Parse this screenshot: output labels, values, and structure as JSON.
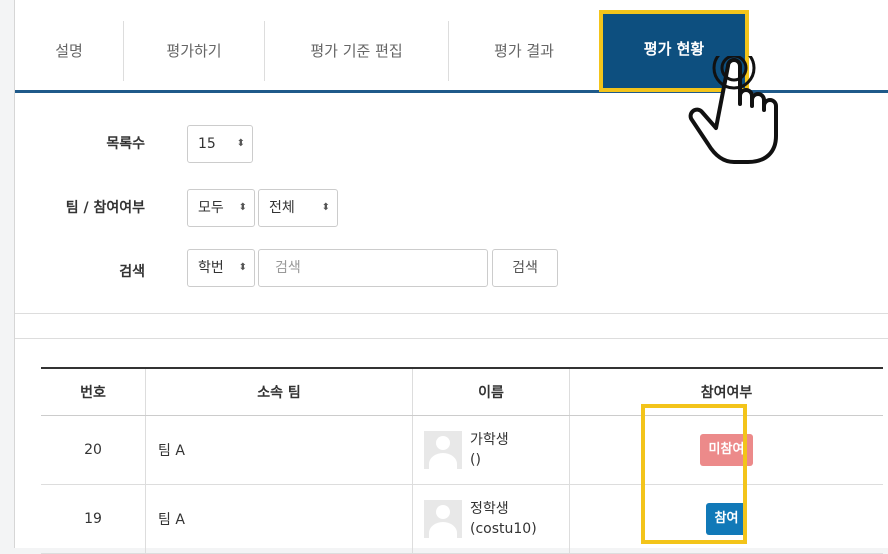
{
  "tabs": [
    {
      "label": "설명",
      "active": false
    },
    {
      "label": "평가하기",
      "active": false
    },
    {
      "label": "평가 기준 편집",
      "active": false
    },
    {
      "label": "평가 결과",
      "active": false
    },
    {
      "label": "평가 현황",
      "active": true
    }
  ],
  "filters": {
    "list_count_label": "목록수",
    "list_count_value": "15",
    "team_label": "팀 / 참여여부",
    "team_value": "모두",
    "participation_value": "전체",
    "search_label": "검색",
    "search_field_value": "학번",
    "search_placeholder": "검색",
    "search_button": "검색"
  },
  "table": {
    "headers": [
      "번호",
      "소속 팀",
      "이름",
      "참여여부"
    ],
    "rows": [
      {
        "num": "20",
        "team": "팀 A",
        "name": "가학생",
        "id": "()",
        "status": "미참여",
        "status_color": "#ec8a8a"
      },
      {
        "num": "19",
        "team": "팀 A",
        "name": "정학생",
        "id": "(costu10)",
        "status": "참여",
        "status_color": "#1179b8"
      }
    ]
  },
  "colors": {
    "active_tab": "#0d4f7f",
    "highlight": "#f3c41a",
    "tab_underline": "#1f5a8a"
  },
  "icons": [
    "sort-arrows-icon",
    "avatar-icon",
    "pointer-hand-icon"
  ]
}
